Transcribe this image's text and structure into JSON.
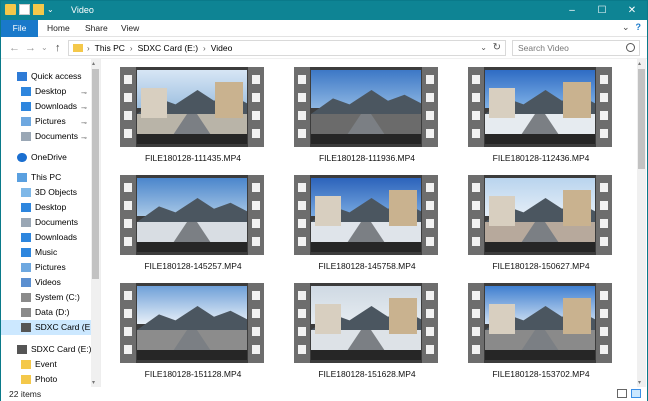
{
  "window": {
    "title": "Video",
    "controls": {
      "minimize": "–",
      "maximize": "☐",
      "close": "✕"
    }
  },
  "ribbon": {
    "tabs": [
      "File",
      "Home",
      "Share",
      "View"
    ],
    "right_icons": {
      "collapse": "⌄",
      "help": "?"
    }
  },
  "address": {
    "back": "←",
    "forward": "→",
    "recent": "⌄",
    "up": "↑",
    "crumbs": [
      "This PC",
      "SDXC Card (E:)",
      "Video"
    ],
    "separator": "›",
    "dropdown": "⌄",
    "refresh": "↻",
    "search_placeholder": "Search Video"
  },
  "nav": {
    "items": [
      {
        "label": "Quick access",
        "icon": "star-icon",
        "level": 0,
        "pinned": false
      },
      {
        "label": "Desktop",
        "icon": "desktop-folder-icon",
        "level": 1,
        "pinned": true
      },
      {
        "label": "Downloads",
        "icon": "downloads-icon",
        "level": 1,
        "pinned": true
      },
      {
        "label": "Pictures",
        "icon": "pictures-icon",
        "level": 1,
        "pinned": true
      },
      {
        "label": "Documents",
        "icon": "documents-icon",
        "level": 1,
        "pinned": true
      },
      {
        "label": "OneDrive",
        "icon": "cloud-icon",
        "level": 0,
        "pinned": false
      },
      {
        "label": "This PC",
        "icon": "computer-icon",
        "level": 0,
        "pinned": false
      },
      {
        "label": "3D Objects",
        "icon": "cube-folder-icon",
        "level": 1,
        "pinned": false
      },
      {
        "label": "Desktop",
        "icon": "desktop-folder-icon",
        "level": 1,
        "pinned": false
      },
      {
        "label": "Documents",
        "icon": "documents-icon",
        "level": 1,
        "pinned": false
      },
      {
        "label": "Downloads",
        "icon": "downloads-icon",
        "level": 1,
        "pinned": false
      },
      {
        "label": "Music",
        "icon": "music-icon",
        "level": 1,
        "pinned": false
      },
      {
        "label": "Pictures",
        "icon": "pictures-icon",
        "level": 1,
        "pinned": false
      },
      {
        "label": "Videos",
        "icon": "videos-icon",
        "level": 1,
        "pinned": false
      },
      {
        "label": "System (C:)",
        "icon": "drive-icon",
        "level": 1,
        "pinned": false
      },
      {
        "label": "Data (D:)",
        "icon": "drive-icon",
        "level": 1,
        "pinned": false
      },
      {
        "label": "SDXC Card (E:)",
        "icon": "sd-card-icon",
        "level": 1,
        "pinned": false,
        "selected": true
      },
      {
        "label": "SDXC Card (E:)",
        "icon": "sd-card-icon",
        "level": 0,
        "pinned": false
      },
      {
        "label": "Event",
        "icon": "folder-icon",
        "level": 1,
        "pinned": false
      },
      {
        "label": "Photo",
        "icon": "folder-icon",
        "level": 1,
        "pinned": false
      }
    ],
    "pin_glyph": "⊸"
  },
  "files": [
    {
      "name": "FILE180128-111435.MP4",
      "scene": "sun"
    },
    {
      "name": "FILE180128-111936.MP4",
      "scene": "mountain"
    },
    {
      "name": "FILE180128-112436.MP4",
      "scene": "buildings"
    },
    {
      "name": "FILE180128-145257.MP4",
      "scene": "cars"
    },
    {
      "name": "FILE180128-145758.MP4",
      "scene": "town"
    },
    {
      "name": "FILE180128-150627.MP4",
      "scene": "wall"
    },
    {
      "name": "FILE180128-151128.MP4",
      "scene": "sun2"
    },
    {
      "name": "FILE180128-151628.MP4",
      "scene": "block"
    },
    {
      "name": "FILE180128-153702.MP4",
      "scene": "parking"
    }
  ],
  "status": {
    "count": "22 items"
  },
  "colors": {
    "titlebar": "#0e8494",
    "file_tab": "#1979ca",
    "selection": "#cce8ff"
  }
}
